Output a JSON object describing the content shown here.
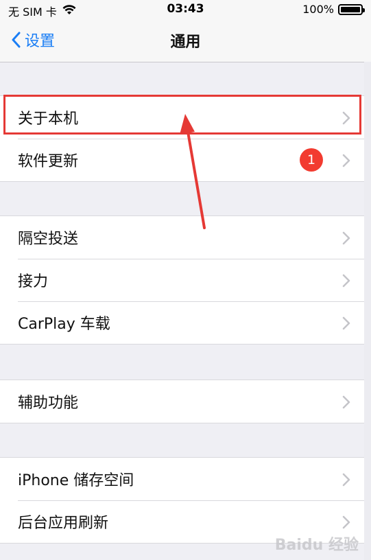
{
  "status_bar": {
    "carrier": "无 SIM 卡",
    "time": "03:43",
    "battery": "100%"
  },
  "nav": {
    "back_label": "设置",
    "title": "通用"
  },
  "groups": [
    [
      {
        "label": "关于本机"
      },
      {
        "label": "软件更新",
        "badge": "1"
      }
    ],
    [
      {
        "label": "隔空投送"
      },
      {
        "label": "接力"
      },
      {
        "label": "CarPlay 车载"
      }
    ],
    [
      {
        "label": "辅助功能"
      }
    ],
    [
      {
        "label": "iPhone 储存空间"
      },
      {
        "label": "后台应用刷新"
      }
    ]
  ],
  "watermark": "Baidu 经验",
  "colors": {
    "accent": "#1a7ef5",
    "badge": "#f23b30",
    "highlight": "#e53935"
  }
}
